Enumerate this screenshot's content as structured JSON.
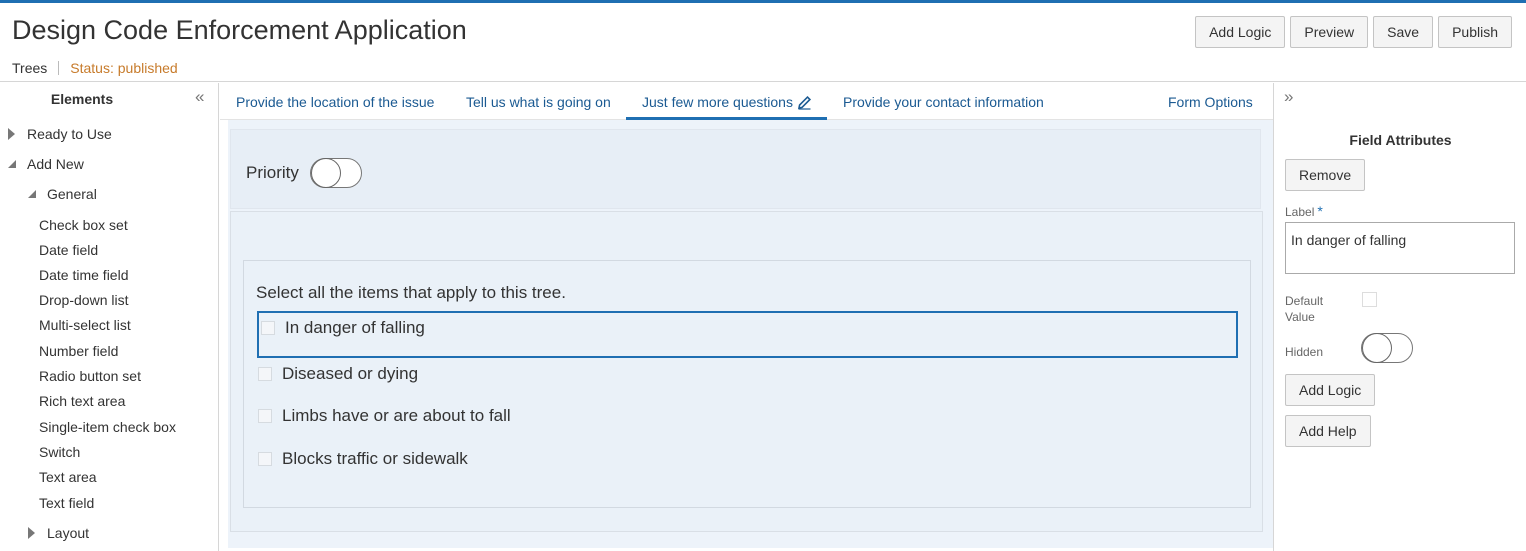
{
  "header": {
    "title": "Design Code Enforcement Application",
    "breadcrumb": "Trees",
    "status": "Status: published",
    "buttons": {
      "add_logic": "Add Logic",
      "preview": "Preview",
      "save": "Save",
      "publish": "Publish"
    }
  },
  "sidebar": {
    "title": "Elements",
    "collapse_icon": "«",
    "ready_to_use": "Ready to Use",
    "add_new": "Add New",
    "general": "General",
    "items": [
      "Check box set",
      "Date field",
      "Date time field",
      "Drop-down list",
      "Multi-select list",
      "Number field",
      "Radio button set",
      "Rich text area",
      "Single-item check box",
      "Switch",
      "Text area",
      "Text field"
    ],
    "layout": "Layout"
  },
  "tabs": {
    "items": [
      "Provide the location of the issue",
      "Tell us what is going on",
      "Just few more questions",
      "Provide your contact information"
    ],
    "active": "Just few more questions",
    "form_options": "Form Options"
  },
  "form": {
    "priority_label": "Priority",
    "priority_on": false,
    "question": "Select all the items that apply to this tree.",
    "options": [
      "In danger of falling",
      "Diseased or dying",
      "Limbs have or are about to fall",
      "Blocks traffic or sidewalk"
    ]
  },
  "attributes": {
    "expand_icon": "»",
    "title": "Field Attributes",
    "remove": "Remove",
    "label_caption": "Label",
    "required_mark": "*",
    "label_value": "In danger of falling",
    "default_caption_1": "Default",
    "default_caption_2": "Value",
    "default_checked": false,
    "hidden_caption": "Hidden",
    "hidden_on": false,
    "add_logic": "Add Logic",
    "add_help": "Add Help"
  },
  "colors": {
    "accent": "#1f6fb2",
    "status": "#c77b2b",
    "tab_text": "#1b5a92",
    "canvas_bg": "#edf3fa"
  }
}
